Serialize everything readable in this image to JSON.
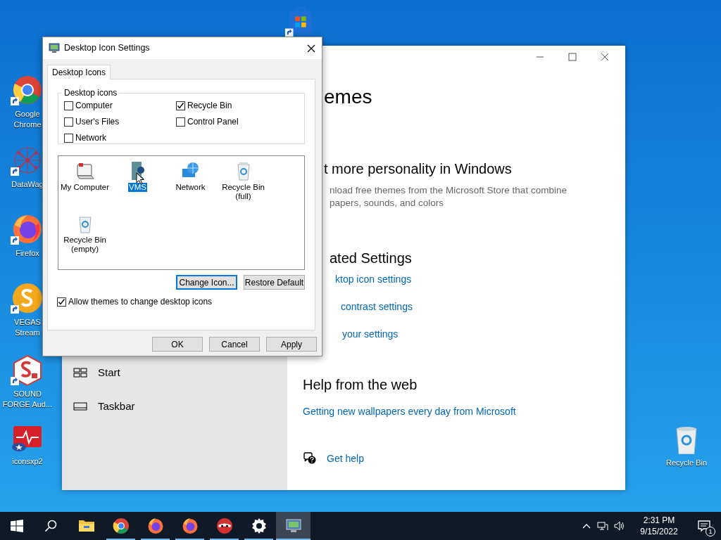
{
  "desktop_icons": [
    {
      "label": "Google Chrome",
      "shortcut": true
    },
    {
      "label": "DataWag",
      "shortcut": true
    },
    {
      "label": "Firefox",
      "shortcut": true
    },
    {
      "label": "VEGAS Stream",
      "shortcut": true
    },
    {
      "label": "SOUND FORGE Aud...",
      "shortcut": true
    },
    {
      "label": "iconsxp2",
      "shortcut": false
    },
    {
      "label": "Recycle Bin",
      "shortcut": false
    }
  ],
  "settings_window": {
    "sidebar_items": [
      {
        "label": "Start"
      },
      {
        "label": "Taskbar"
      }
    ],
    "title_fragment": "emes",
    "personality_heading": "t more personality in Windows",
    "description_lines": [
      "nload free themes from the Microsoft Store that combine",
      "papers, sounds, and colors"
    ],
    "related_heading": "ated Settings",
    "related_links": [
      "ktop icon settings",
      "contrast settings",
      "your settings"
    ],
    "help_heading": "Help from the web",
    "help_link": "Getting new wallpapers every day from Microsoft",
    "get_help": "Get help"
  },
  "dialog": {
    "title": "Desktop Icon Settings",
    "tabs": [
      {
        "label": "Desktop Icons",
        "selected": true
      }
    ],
    "group_label": "Desktop icons",
    "checkboxes": [
      {
        "label": "Computer",
        "checked": false
      },
      {
        "label": "Recycle Bin",
        "checked": true
      },
      {
        "label": "User's Files",
        "checked": false
      },
      {
        "label": "Control Panel",
        "checked": false
      },
      {
        "label": "Network",
        "checked": false
      }
    ],
    "icons": [
      {
        "label": "My Computer",
        "selected": false
      },
      {
        "label": "VMS",
        "selected": true
      },
      {
        "label": "Network",
        "selected": false
      },
      {
        "label": "Recycle Bin (full)",
        "selected": false
      },
      {
        "label": "Recycle Bin (empty)",
        "selected": false
      }
    ],
    "change_icon_button": "Change Icon...",
    "restore_button": "Restore Default",
    "allow_themes": {
      "label": "Allow themes to change desktop icons",
      "checked": true
    },
    "buttons": [
      "OK",
      "Cancel",
      "Apply"
    ]
  },
  "taskbar": {
    "apps": [
      {
        "running": false,
        "selected": false
      },
      {
        "running": true,
        "selected": false
      },
      {
        "running": true,
        "selected": false
      },
      {
        "running": true,
        "selected": false
      },
      {
        "running": true,
        "selected": false
      },
      {
        "running": true,
        "selected": false
      },
      {
        "running": true,
        "selected": true
      }
    ],
    "time": "2:31 PM",
    "date": "9/15/2022",
    "notification_count": "1"
  }
}
